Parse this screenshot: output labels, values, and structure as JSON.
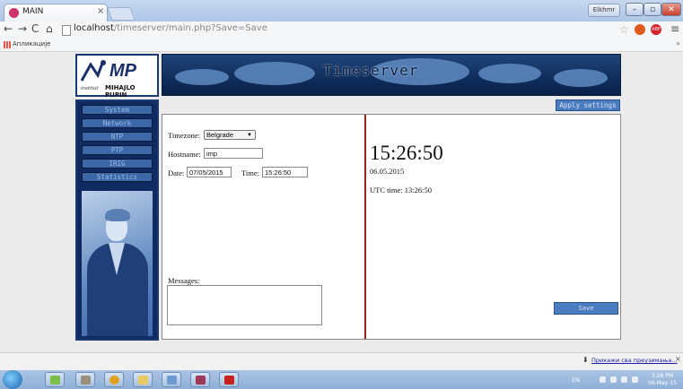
{
  "browser": {
    "tab_title": "MAIN",
    "tab_close": "×",
    "user_badge": "Elkhmr",
    "window_controls": {
      "minimize": "–",
      "maximize": "▫",
      "close": "✕"
    },
    "url_host": "localhost",
    "url_path": "/timeserver/main.php?Save=Save",
    "nav": {
      "back": "←",
      "forward": "→",
      "reload": "C",
      "home": "⌂"
    },
    "star": "☆",
    "menu": "≡",
    "extension_abp": "ABP",
    "bookmarks_label": "Апликације",
    "bookmarks_more": "»"
  },
  "logo": {
    "mark": "MP",
    "institute": "institut",
    "name": "MIHAJLO PUPIN"
  },
  "banner": {
    "title": "Timeserver"
  },
  "sidebar": {
    "items": [
      {
        "label": "System"
      },
      {
        "label": "Network"
      },
      {
        "label": "NTP"
      },
      {
        "label": "PTP"
      },
      {
        "label": "IRIG"
      },
      {
        "label": "Statistics"
      }
    ]
  },
  "settings": {
    "apply_label": "Apply settings",
    "timezone_label": "Timezone:",
    "timezone_value": "Belgrade",
    "hostname_label": "Hostname:",
    "hostname_value": "imp",
    "date_label": "Date:",
    "date_value": "07/05/2015",
    "time_label": "Time:",
    "time_value": "15:26:50",
    "messages_label": "Messages:",
    "save_label": "Save"
  },
  "clock": {
    "time": "15:26:50",
    "date": "06.05.2015",
    "utc": "UTC time: 13:26:50"
  },
  "download_bar": {
    "link": "Прикажи сва преузимања...",
    "icon": "⬇",
    "close": "×"
  },
  "taskbar": {
    "language": "EN",
    "clock_time": "3:26 PM",
    "clock_date": "06-May-15"
  },
  "colors": {
    "nav_blue": "#0f2b61",
    "button_blue": "#4a7cc0",
    "divider_red": "#9c2320"
  }
}
